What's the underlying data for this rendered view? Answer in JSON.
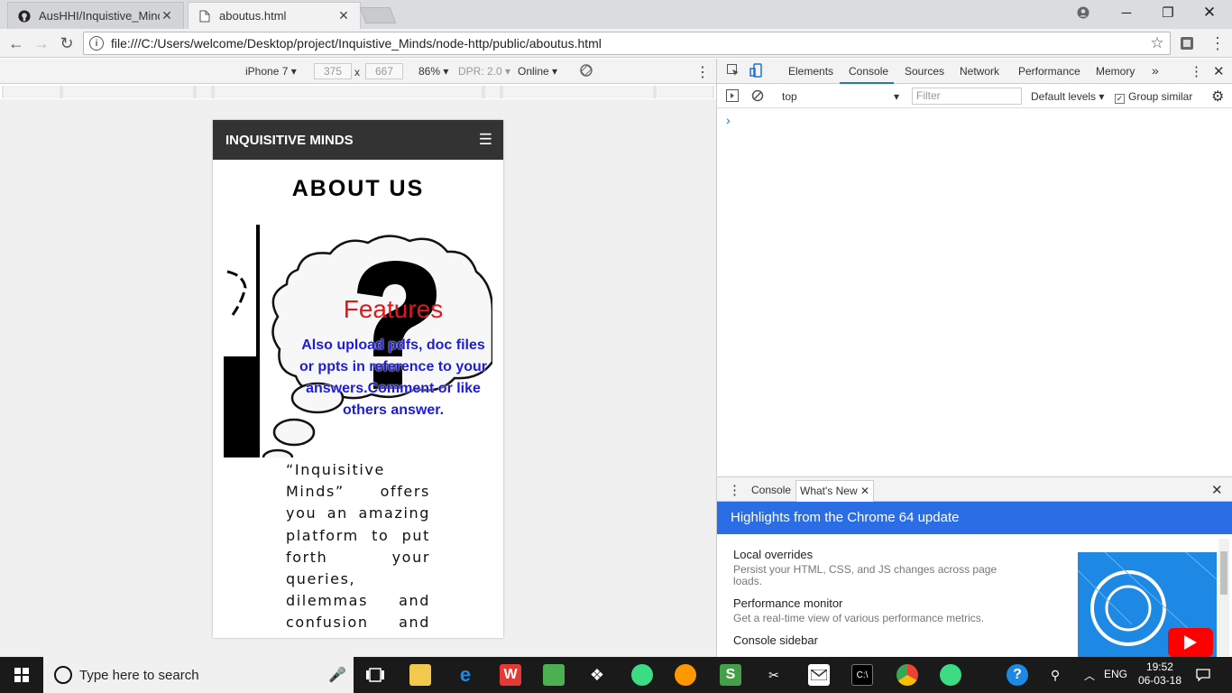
{
  "browser": {
    "tabs": [
      {
        "label": "AusHHI/Inquistive_Minds",
        "icon": "github-icon"
      },
      {
        "label": "aboutus.html",
        "icon": "file-icon"
      }
    ],
    "url": "file:///C:/Users/welcome/Desktop/project/Inquistive_Minds/node-http/public/aboutus.html"
  },
  "device_toolbar": {
    "device": "iPhone 7",
    "width": "375",
    "times": "x",
    "height": "667",
    "zoom": "86%",
    "dpr": "DPR: 2.0",
    "network": "Online"
  },
  "page": {
    "brand": "INQUISITIVE MINDS",
    "menu_glyph": "☰",
    "title": "ABOUT US",
    "feature_title": "Features",
    "feature_desc": "Also upload pdfs, doc files or ppts in reference to your answers.Comment or like others answer.",
    "body": "“Inquisitive Minds” offers you an amazing platform to put forth your queries, dilemmas and confusion and get the guidance"
  },
  "devtools": {
    "tabs": [
      "Elements",
      "Console",
      "Sources",
      "Network",
      "Performance",
      "Memory"
    ],
    "overflow": "»",
    "context": "top",
    "filter_placeholder": "Filter",
    "levels": "Default levels",
    "group_similar": "Group similar",
    "prompt": "›",
    "drawer_tabs": [
      "Console",
      "What's New"
    ],
    "whats_new_title": "Highlights from the Chrome 64 update",
    "whats_new_items": [
      {
        "title": "Local overrides",
        "desc": "Persist your HTML, CSS, and JS changes across page loads."
      },
      {
        "title": "Performance monitor",
        "desc": "Get a real-time view of various performance metrics."
      },
      {
        "title": "Console sidebar",
        "desc": ""
      }
    ]
  },
  "taskbar": {
    "search_placeholder": "Type here to search",
    "language": "ENG",
    "time": "19:52",
    "date": "06-03-18"
  },
  "colors": {
    "accent": "#1a73e8",
    "whats_new_header": "#2a6de5",
    "feature_title": "#e3161c",
    "feature_desc": "#1c1ae0",
    "site_nav": "#333333"
  }
}
